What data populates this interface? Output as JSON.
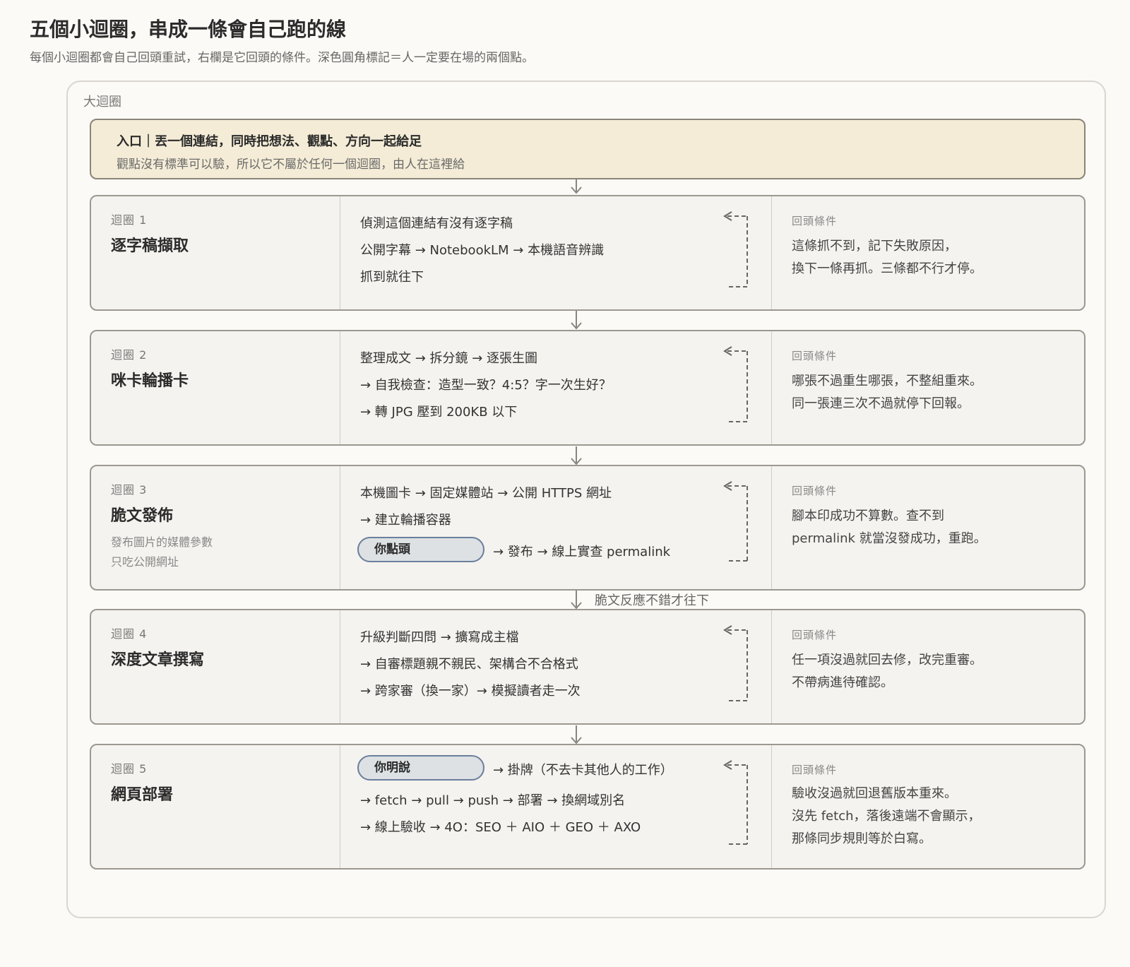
{
  "header": {
    "title": "五個小迴圈，串成一條會自己跑的線",
    "subtitle": "每個小迴圈都會自己回頭重試，右欄是它回頭的條件。深色圓角標記＝人一定要在場的兩個點。"
  },
  "outer_label": "大迴圈",
  "entry": {
    "title": "入口｜丟一個連結，同時把想法、觀點、方向一起給足",
    "desc": "觀點沒有標準可以驗，所以它不屬於任何一個迴圈，由人在這裡給"
  },
  "return_label": "回頭條件",
  "between_label": "脆文反應不錯才往下",
  "loops": [
    {
      "num": "迴圈 1",
      "name": "逐字稿擷取",
      "steps": [
        "偵測這個連結有沒有逐字稿",
        "公開字幕 → NotebookLM → 本機語音辨識",
        "抓到就往下"
      ],
      "returns": [
        "這條抓不到，記下失敗原因，",
        "換下一條再抓。三條都不行才停。"
      ]
    },
    {
      "num": "迴圈 2",
      "name": "咪卡輪播卡",
      "steps": [
        "整理成文 → 拆分鏡 → 逐張生圖",
        "→ 自我檢查：造型一致？4:5？字一次生好？",
        "→ 轉 JPG 壓到 200KB 以下"
      ],
      "returns": [
        "哪張不過重生哪張，不整組重來。",
        "同一張連三次不過就停下回報。"
      ]
    },
    {
      "num": "迴圈 3",
      "name": "脆文發佈",
      "notes": [
        "發布圖片的媒體參數",
        "只吃公開網址"
      ],
      "steps": [
        "本機圖卡 → 固定媒體站 → 公開 HTTPS 網址",
        "→ 建立輪播容器"
      ],
      "pill": "你點頭",
      "after_pill": "→ 發布 → 線上實查 permalink",
      "returns": [
        "腳本印成功不算數。查不到",
        "permalink 就當沒發成功，重跑。"
      ]
    },
    {
      "num": "迴圈 4",
      "name": "深度文章撰寫",
      "steps": [
        "升級判斷四問 → 擴寫成主檔",
        "→ 自審標題親不親民、架構合不合格式",
        "→ 跨家審（換一家）→ 模擬讀者走一次"
      ],
      "returns": [
        "任一項沒過就回去修，改完重審。",
        "不帶病進待確認。"
      ]
    },
    {
      "num": "迴圈 5",
      "name": "網頁部署",
      "pill": "你明說",
      "after_pill": "→ 掛牌（不去卡其他人的工作）",
      "steps": [
        "→ fetch → pull → push → 部署 → 換網域別名",
        "→ 線上驗收 → 4O：SEO ＋ AIO ＋ GEO ＋ AXO"
      ],
      "returns": [
        "驗收沒過就回退舊版本重來。",
        "沒先 fetch，落後遠端不會顯示，",
        "那條同步規則等於白寫。"
      ]
    }
  ]
}
